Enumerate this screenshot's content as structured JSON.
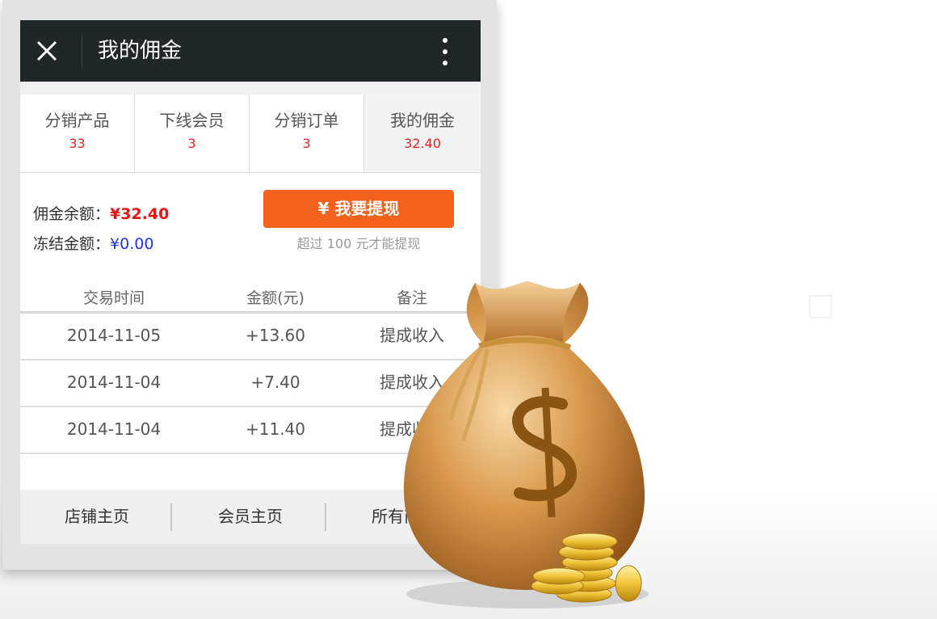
{
  "titlebar": {
    "title": "我的佣金",
    "close_icon": "close-icon",
    "more_icon": "more-vertical-icon"
  },
  "stats": [
    {
      "label": "分销产品",
      "value": "33"
    },
    {
      "label": "下线会员",
      "value": "3"
    },
    {
      "label": "分销订单",
      "value": "3"
    },
    {
      "label": "我的佣金",
      "value": "32.40",
      "active": true
    }
  ],
  "balance": {
    "available_label": "佣金余额：",
    "available_value": "¥32.40",
    "frozen_label": "冻结金额：",
    "frozen_value": "¥0.00"
  },
  "withdraw": {
    "button_label": "¥ 我要提现",
    "note": "超过 100 元才能提现"
  },
  "table": {
    "headers": [
      "交易时间",
      "金额(元)",
      "备注"
    ],
    "rows": [
      [
        "2014-11-05",
        "+13.60",
        "提成收入"
      ],
      [
        "2014-11-04",
        "+7.40",
        "提成收入"
      ],
      [
        "2014-11-04",
        "+11.40",
        "提成收入"
      ]
    ]
  },
  "footer": [
    "店铺主页",
    "会员主页",
    "所有商品"
  ],
  "colors": {
    "accent": "#f2621c",
    "titlebar": "#212629",
    "red": "#ee2222",
    "blue": "#2233ee"
  },
  "illustration": {
    "icon": "money-bag-icon"
  }
}
